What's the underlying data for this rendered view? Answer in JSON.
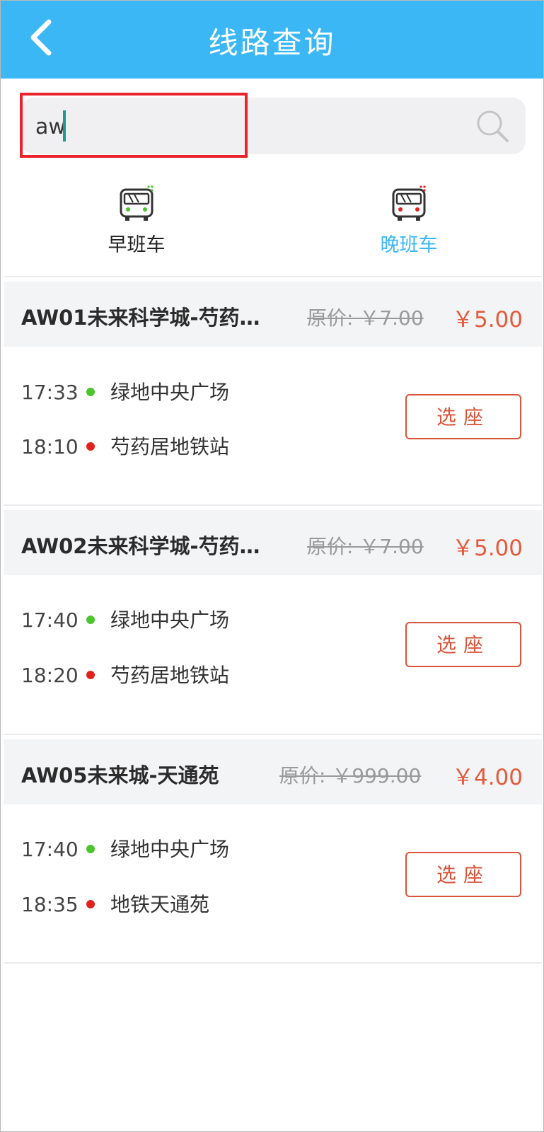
{
  "header": {
    "title": "线路查询",
    "back_icon": "chevron-left-icon",
    "bg_color": "#3bb7f6"
  },
  "search": {
    "value": "aw",
    "placeholder": "",
    "icon": "search-icon"
  },
  "tabs": [
    {
      "label": "早班车",
      "icon": "bus-icon",
      "active": false
    },
    {
      "label": "晚班车",
      "icon": "bus-icon",
      "active": true
    }
  ],
  "routes": [
    {
      "name": "AW01未来科学城-芍药…",
      "original_price": "原价: ￥7.00",
      "price": "￥5.00",
      "stops": [
        {
          "time": "17:33",
          "name": "绿地中央广场",
          "color": "#4ac52c"
        },
        {
          "time": "18:10",
          "name": "芍药居地铁站",
          "color": "#e2211c"
        }
      ],
      "button": "选座"
    },
    {
      "name": "AW02未来科学城-芍药…",
      "original_price": "原价: ￥7.00",
      "price": "￥5.00",
      "stops": [
        {
          "time": "17:40",
          "name": "绿地中央广场",
          "color": "#4ac52c"
        },
        {
          "time": "18:20",
          "name": "芍药居地铁站",
          "color": "#e2211c"
        }
      ],
      "button": "选座"
    },
    {
      "name": "AW05未来城-天通苑",
      "original_price": "原价: ￥999.00",
      "price": "￥4.00",
      "stops": [
        {
          "time": "17:40",
          "name": "绿地中央广场",
          "color": "#4ac52c"
        },
        {
          "time": "18:35",
          "name": "地铁天通苑",
          "color": "#e2211c"
        }
      ],
      "button": "选座"
    }
  ],
  "colors": {
    "accent": "#3bb7f6",
    "price": "#e45a3c",
    "highlight": "#e8232b"
  }
}
